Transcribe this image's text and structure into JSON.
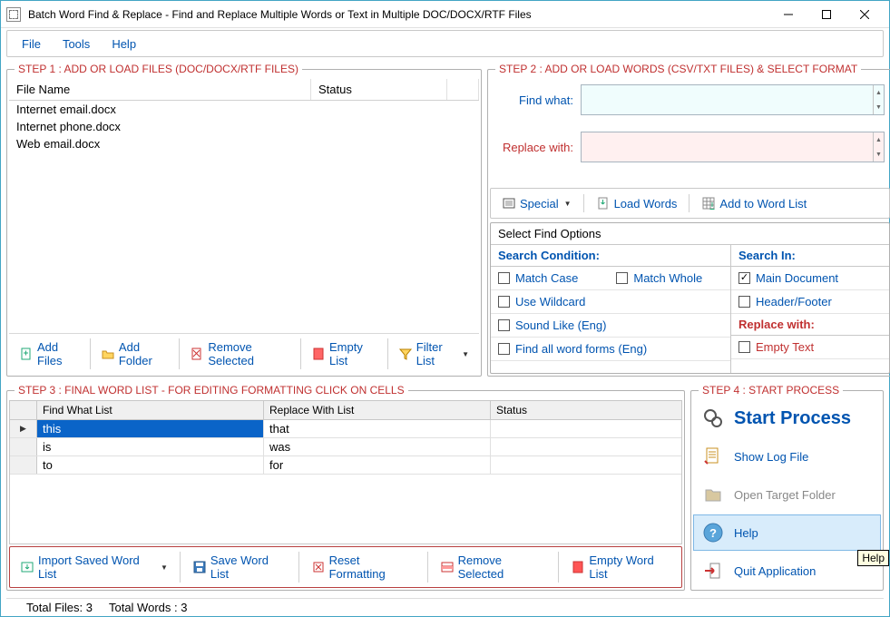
{
  "window": {
    "title": "Batch Word Find & Replace - Find and Replace Multiple Words or Text  in Multiple DOC/DOCX/RTF Files"
  },
  "menu": {
    "file": "File",
    "tools": "Tools",
    "help": "Help"
  },
  "step1": {
    "legend": "STEP 1 : ADD OR LOAD FILES (DOC/DOCX/RTF FILES)",
    "cols": {
      "filename": "File Name",
      "status": "Status"
    },
    "files": [
      {
        "name": "Internet email.docx",
        "status": ""
      },
      {
        "name": "Internet phone.docx",
        "status": ""
      },
      {
        "name": "Web email.docx",
        "status": ""
      }
    ],
    "toolbar": {
      "add_files": "Add Files",
      "add_folder": "Add Folder",
      "remove_selected": "Remove Selected",
      "empty_list": "Empty List",
      "filter_list": "Filter List"
    }
  },
  "step2": {
    "legend": "STEP 2 : ADD OR LOAD WORDS (CSV/TXT FILES) & SELECT FORMAT",
    "find_label": "Find what:",
    "replace_label": "Replace with:",
    "toolbar": {
      "special": "Special",
      "load_words": "Load Words",
      "add_wordlist": "Add to Word List"
    },
    "options_title": "Select Find Options",
    "cond_head": "Search Condition:",
    "in_head": "Search In:",
    "replace_head": "Replace with:",
    "match_case": "Match Case",
    "match_whole": "Match Whole",
    "use_wildcard": "Use Wildcard",
    "sound_like": "Sound Like (Eng)",
    "find_forms": "Find all word forms (Eng)",
    "main_doc": "Main Document",
    "header_footer": "Header/Footer",
    "empty_text": "Empty Text"
  },
  "step3": {
    "legend": "STEP 3 : FINAL WORD LIST - FOR EDITING FORMATTING CLICK ON CELLS",
    "cols": {
      "find": "Find What List",
      "replace": "Replace With List",
      "status": "Status"
    },
    "rows": [
      {
        "find": "this",
        "replace": "that",
        "status": ""
      },
      {
        "find": "is",
        "replace": "was",
        "status": ""
      },
      {
        "find": "to",
        "replace": "for",
        "status": ""
      }
    ],
    "toolbar": {
      "import": "Import Saved Word List",
      "save": "Save Word List",
      "reset": "Reset Formatting",
      "remove": "Remove Selected",
      "empty": "Empty Word List"
    }
  },
  "step4": {
    "legend": "STEP 4 : START PROCESS",
    "start": "Start Process",
    "log": "Show Log File",
    "open_folder": "Open Target Folder",
    "help": "Help",
    "quit": "Quit Application"
  },
  "status": {
    "total_files": "Total Files: 3",
    "total_words": "Total Words : 3"
  },
  "tooltip": {
    "help": "Help"
  }
}
